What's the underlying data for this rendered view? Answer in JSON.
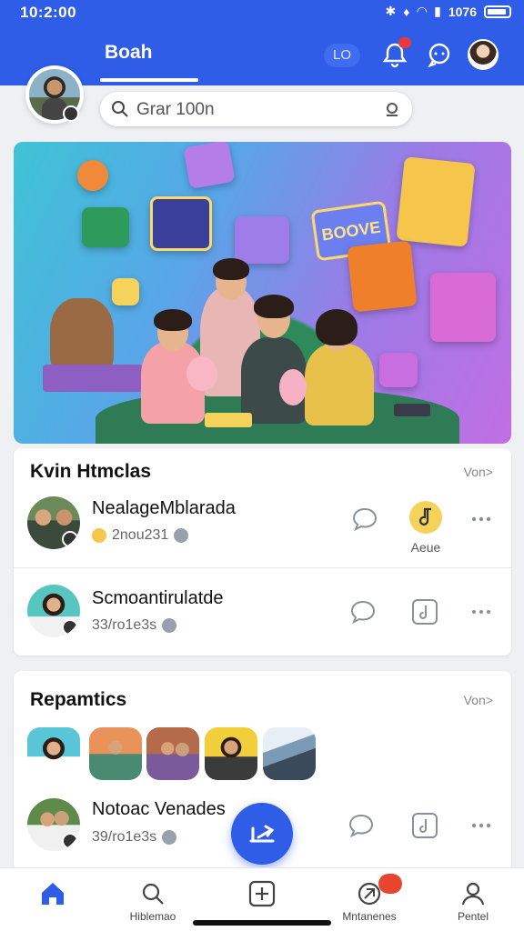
{
  "status_bar": {
    "time": "10:2:00",
    "battery_text": "1076"
  },
  "header": {
    "tab_label": "Boah",
    "chip_label": "LO",
    "icons": [
      "notification-bell-icon",
      "chat-icon",
      "profile-avatar"
    ]
  },
  "search": {
    "placeholder": "Grar 100n"
  },
  "hero": {
    "label": "BOOVE"
  },
  "live_section": {
    "title": "Kvin Htmclas",
    "view_more": "Von>",
    "rows": [
      {
        "name": "NealageMblarada",
        "meta": "2nou231",
        "action_label": "Aeue"
      },
      {
        "name": "Scmoantirulatde",
        "meta": "33/ro1e3s",
        "action_label": ""
      }
    ]
  },
  "reparitics_section": {
    "title": "Repamtics",
    "view_more": "Von>",
    "row": {
      "name": "Notoac Venades",
      "meta": "39/ro1e3s"
    }
  },
  "bottom_nav": {
    "items": [
      {
        "label": "",
        "icon": "home-icon"
      },
      {
        "label": "Hiblemao",
        "icon": "search-icon"
      },
      {
        "label": "",
        "icon": "add-icon"
      },
      {
        "label": "Mntanenes",
        "icon": "messages-icon",
        "badge": ""
      },
      {
        "label": "Pentel",
        "icon": "profile-icon"
      }
    ]
  },
  "colors": {
    "primary": "#2f5de8",
    "badge": "#e8452e",
    "accent_yellow": "#f5d35b"
  }
}
